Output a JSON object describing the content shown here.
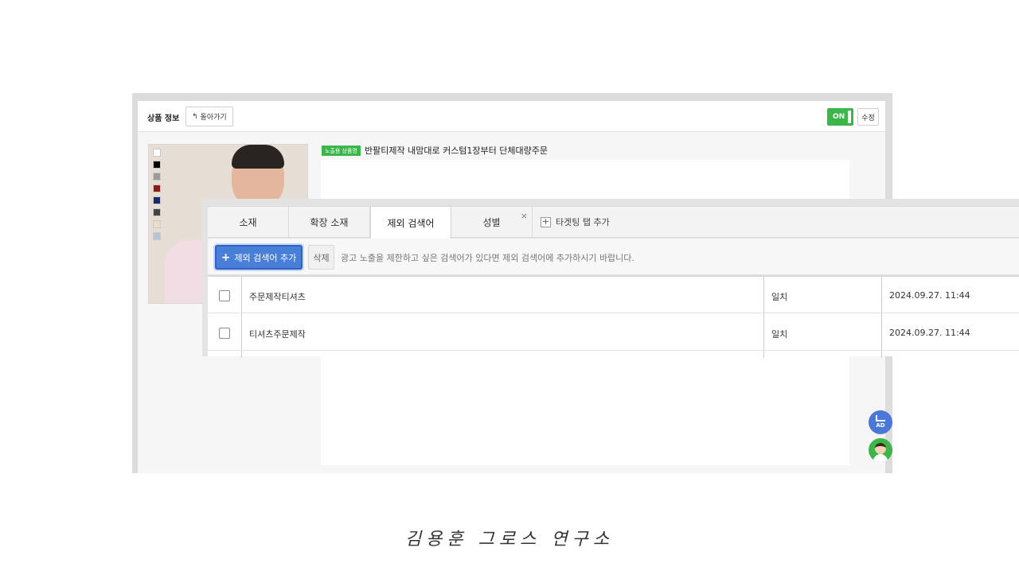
{
  "product_panel": {
    "title": "상품 정보",
    "back_button_label": "돌아가기",
    "toggle_label": "ON",
    "edit_button_label": "수정",
    "product_tag": "노출용 상품명",
    "product_name": "반팔티제작 내맘대로 커스텀1장부터 단체대량주문",
    "swatch_colors": [
      "#ffffff",
      "#000000",
      "#9a9a9a",
      "#8b1a1a",
      "#1a2a66",
      "#444444",
      "#e9dfc3",
      "#b7c3d6"
    ]
  },
  "floating_buttons": {
    "ad_label": "AD"
  },
  "keyword_panel": {
    "tabs": [
      {
        "label": "소재",
        "active": false
      },
      {
        "label": "확장 소재",
        "active": false
      },
      {
        "label": "제외 검색어",
        "active": true
      },
      {
        "label": "성별",
        "active": false
      }
    ],
    "tab_close_glyph": "×",
    "add_targeting_label": "타겟팅 탭 추가",
    "add_keyword_label": "제외 검색어 추가",
    "delete_label": "삭제",
    "hint": "광고 노출을 제한하고 싶은 검색어가 있다면 제외 검색어에 추가하시기 바랍니다.",
    "rows": [
      {
        "keyword": "주문제작티셔츠",
        "match": "일치",
        "date": "2024.09.27. 11:44"
      },
      {
        "keyword": "티셔츠주문제작",
        "match": "일치",
        "date": "2024.09.27. 11:44"
      }
    ]
  },
  "caption": "김용훈 그로스 연구소",
  "colors": {
    "accent_blue": "#4a7fd9",
    "on_green": "#3cb54a"
  }
}
